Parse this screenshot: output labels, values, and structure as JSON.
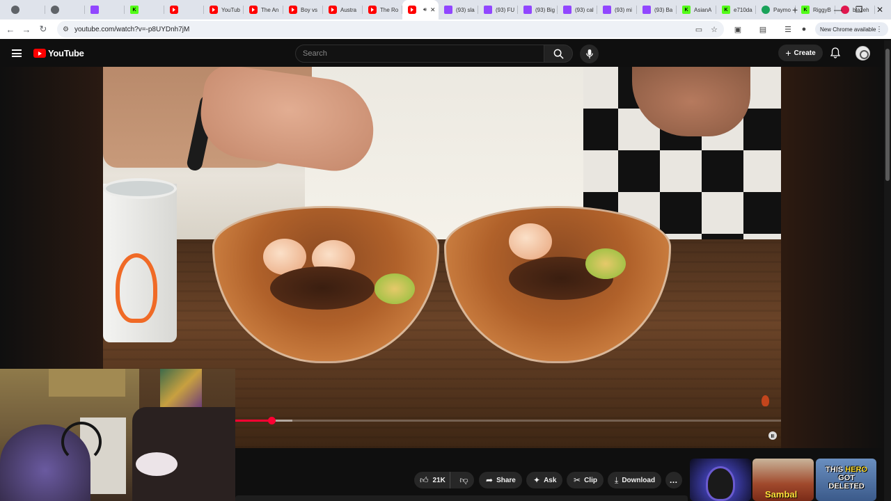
{
  "browser": {
    "tabs": [
      {
        "label": "",
        "favicon": "chrome-icon"
      },
      {
        "label": "",
        "favicon": "blank-icon"
      },
      {
        "label": "",
        "favicon": "twitch-icon"
      },
      {
        "label": "",
        "favicon": "kick-icon"
      },
      {
        "label": "",
        "favicon": "youtube-icon"
      },
      {
        "label": "YouTub",
        "favicon": "youtube-icon"
      },
      {
        "label": "The An",
        "favicon": "youtube-icon"
      },
      {
        "label": "Boy vs",
        "favicon": "youtube-icon"
      },
      {
        "label": "Austra",
        "favicon": "youtube-icon"
      },
      {
        "label": "The Ro",
        "favicon": "youtube-icon"
      },
      {
        "label": "",
        "favicon": "youtube-icon",
        "active": true
      },
      {
        "label": "(93) sla",
        "favicon": "twitch-icon"
      },
      {
        "label": "(93) FU",
        "favicon": "twitch-icon"
      },
      {
        "label": "(93) Big",
        "favicon": "twitch-icon"
      },
      {
        "label": "(93) cal",
        "favicon": "twitch-icon"
      },
      {
        "label": "(93) mi",
        "favicon": "twitch-icon"
      },
      {
        "label": "(93) Ba",
        "favicon": "twitch-icon"
      },
      {
        "label": "AsianA",
        "favicon": "kick-icon"
      },
      {
        "label": "e710da",
        "favicon": "kick-icon"
      },
      {
        "label": "Paymo",
        "favicon": "paymo-icon"
      },
      {
        "label": "RiggyB",
        "favicon": "kick-icon"
      },
      {
        "label": "blazeh",
        "favicon": "blaze-icon"
      }
    ],
    "url": "youtube.com/watch?v=-p8UYDnh7jM",
    "new_chrome_label": "New Chrome available"
  },
  "youtube": {
    "logo_text": "YouTube",
    "search_placeholder": "Search",
    "create_label": "Create"
  },
  "player": {
    "progress_played_fraction": 0.066,
    "progress_buffered_fraction": 0.105,
    "state": "playing"
  },
  "actions": {
    "like_count": "21K",
    "share_label": "Share",
    "ask_label": "Ask",
    "clip_label": "Clip",
    "download_label": "Download"
  },
  "suggestions": [
    {
      "thumb_text": ""
    },
    {
      "thumb_text": "Sambal"
    },
    {
      "thumb_text_pre": "THIS ",
      "thumb_text_hl": "HERO",
      "thumb_text_post": "GOT DELETED"
    }
  ],
  "colors": {
    "youtube_red": "#ff0000",
    "progress_red": "#ff0033",
    "background": "#0f0f0f"
  }
}
